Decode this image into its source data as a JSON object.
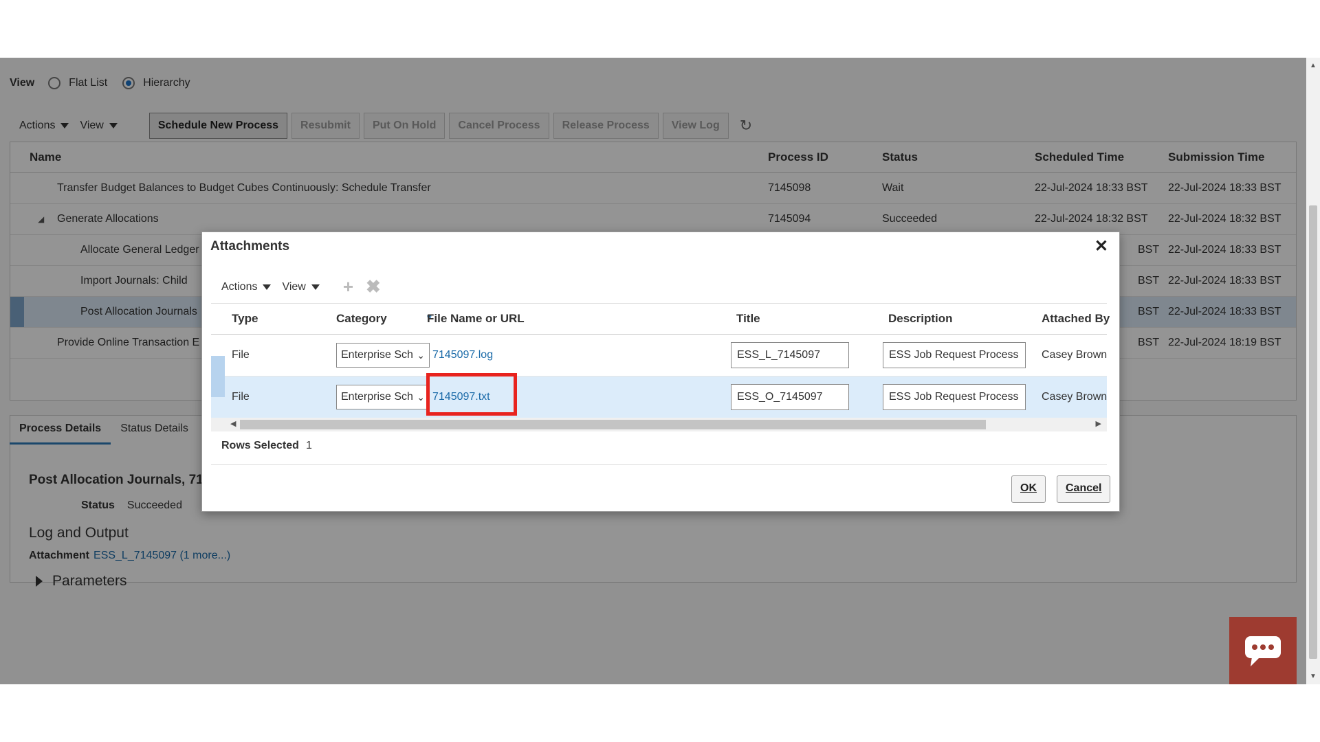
{
  "view": {
    "label": "View",
    "options": [
      {
        "label": "Flat List",
        "selected": false
      },
      {
        "label": "Hierarchy",
        "selected": true
      }
    ]
  },
  "toolbar": {
    "actions_label": "Actions",
    "view_label": "View",
    "buttons": [
      "Schedule New Process",
      "Resubmit",
      "Put On Hold",
      "Cancel Process",
      "Release Process",
      "View Log"
    ],
    "refresh_icon": "refresh-icon"
  },
  "process_table": {
    "columns": [
      "Name",
      "Process ID",
      "Status",
      "Scheduled Time",
      "Submission Time"
    ],
    "rows": [
      {
        "name": "Transfer Budget Balances to Budget Cubes Continuously: Schedule Transfer",
        "id": "7145098",
        "status": "Wait",
        "scheduled": "22-Jul-2024 18:33 BST",
        "submitted": "22-Jul-2024 18:33 BST"
      },
      {
        "name": "Generate Allocations",
        "id": "7145094",
        "status": "Succeeded",
        "scheduled": "22-Jul-2024 18:32 BST",
        "submitted": "22-Jul-2024 18:32 BST"
      },
      {
        "name": "Allocate General Ledger",
        "scheduled_tail": "BST",
        "submitted": "22-Jul-2024 18:33 BST"
      },
      {
        "name": "Import Journals: Child",
        "scheduled_tail": "BST",
        "submitted": "22-Jul-2024 18:33 BST"
      },
      {
        "name": "Post Allocation Journals",
        "scheduled_tail": "BST",
        "submitted": "22-Jul-2024 18:33 BST"
      },
      {
        "name": "Provide Online Transaction E",
        "scheduled_tail": "BST",
        "submitted": "22-Jul-2024 18:19 BST"
      }
    ]
  },
  "details": {
    "tabs": [
      "Process Details",
      "Status Details"
    ],
    "title": "Post Allocation Journals, 71",
    "status_label": "Status",
    "status_value": "Succeeded",
    "log_heading": "Log and Output",
    "attachment_label": "Attachment",
    "attachment_value": "ESS_L_7145097 (1 more...)",
    "parameters_label": "Parameters"
  },
  "dialog": {
    "title": "Attachments",
    "close_icon": "close-icon",
    "actions_label": "Actions",
    "view_label": "View",
    "add_icon": "add-icon",
    "delete_icon": "delete-icon",
    "columns": [
      "Type",
      "Category",
      "File Name or URL",
      "Title",
      "Description",
      "Attached By"
    ],
    "required_marker": "*",
    "rows": [
      {
        "type": "File",
        "category": "Enterprise Sch",
        "file": "7145097.log",
        "title": "ESS_L_7145097",
        "description": "ESS Job Request Process",
        "attached_by": "Casey Brown"
      },
      {
        "type": "File",
        "category": "Enterprise Sch",
        "file": "7145097.txt",
        "title": "ESS_O_7145097",
        "description": "ESS Job Request Process",
        "attached_by": "Casey Brown"
      }
    ],
    "rows_selected_label": "Rows Selected",
    "rows_selected_value": "1",
    "ok_label": "OK",
    "cancel_label": "Cancel"
  },
  "colors": {
    "highlight": "#e8231e",
    "link": "#1a6aa8",
    "footer": "#1f6f78",
    "chat": "#9e3b30"
  }
}
